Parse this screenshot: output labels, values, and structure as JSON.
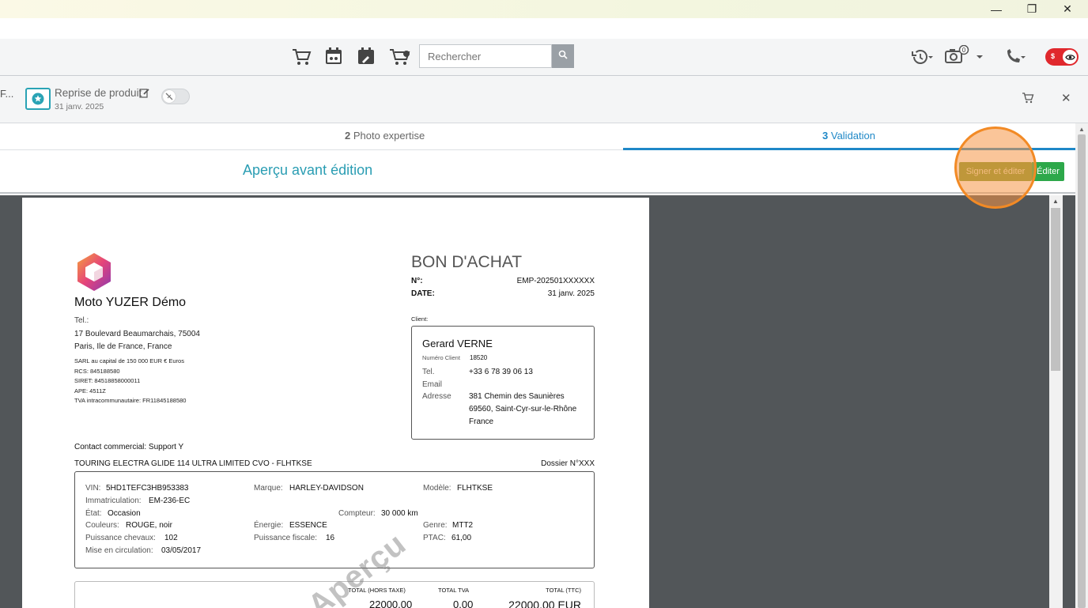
{
  "window": {
    "minimize": "—",
    "maximize": "❐",
    "close": "✕"
  },
  "toolbar": {
    "search_placeholder": "Rechercher",
    "icons": [
      "cart-icon",
      "calendar-icon",
      "repair-icon",
      "moto-cart-icon",
      "search-icon",
      "history-icon",
      "camera-icon",
      "phone-icon"
    ],
    "camera_badge": "0",
    "toggle_symbol": "$"
  },
  "docbar": {
    "truncated_tab": "F...",
    "title": "Reprise de produit",
    "date": "31 janv. 2025"
  },
  "steps": {
    "step2_num": "2",
    "step2_label": "Photo expertise",
    "step3_num": "3",
    "step3_label": "Validation"
  },
  "preview": {
    "title": "Aperçu avant édition",
    "sign_button": "Signer et éditer",
    "edit_button": "Éditer"
  },
  "colors": {
    "accent": "#2a9db3",
    "active_step": "#1f88c7",
    "sign_btn": "#7d9a2e",
    "edit_btn": "#2da84a",
    "highlight": "#f28a25"
  },
  "document": {
    "company_name": "Moto YUZER Démo",
    "tel_label": "Tel.:",
    "address1": "17 Boulevard Beaumarchais, 75004",
    "address2": "Paris, Ile de France, France",
    "legal1": "SARL au capital de 150 000 EUR € Euros",
    "legal2": "RCS: 845188580",
    "legal3": "SIRET: 84518858000011",
    "legal4": "APE: 4511Z",
    "legal5": "TVA intracommunautaire: FR11845188580",
    "doc_title": "BON D'ACHAT",
    "num_label": "N°:",
    "num_value": "EMP-202501XXXXXX",
    "date_label": "DATE:",
    "date_value": "31 janv. 2025",
    "client_label": "Client:",
    "client": {
      "name": "Gerard VERNE",
      "numero_label": "Numéro Client",
      "numero_value": "18520",
      "tel_label": "Tel.",
      "tel_value": "+33 6 78 39 06 13",
      "email_label": "Email",
      "adresse_label": "Adresse",
      "adresse1": "381 Chemin des Saunières",
      "adresse2": "69560, Saint-Cyr-sur-le-Rhône",
      "adresse3": "France"
    },
    "contact": "Contact commercial: Support Y",
    "vehicle_title": "TOURING ELECTRA GLIDE 114 ULTRA LIMITED CVO - FLHTKSE",
    "dossier": "Dossier N°XXX",
    "vehicle": {
      "vin_label": "VIN:",
      "vin": "5HD1TEFC3HB953383",
      "marque_label": "Marque:",
      "marque": "HARLEY-DAVIDSON",
      "modele_label": "Modèle:",
      "modele": "FLHTKSE",
      "immat_label": "Immatriculation:",
      "immat": "EM-236-EC",
      "etat_label": "État:",
      "etat": "Occasion",
      "compteur_label": "Compteur:",
      "compteur": "30 000 km",
      "couleurs_label": "Couleurs:",
      "couleurs": "ROUGE, noir",
      "energie_label": "Énergie:",
      "energie": "ESSENCE",
      "genre_label": "Genre:",
      "genre": "MTT2",
      "chevaux_label": "Puissance chevaux:",
      "chevaux": "102",
      "fiscale_label": "Puissance fiscale:",
      "fiscale": "16",
      "ptac_label": "PTAC:",
      "ptac": "61,00",
      "mec_label": "Mise en circulation:",
      "mec": "03/05/2017"
    },
    "totals": {
      "ht_label": "TOTAL (HORS TAXE)",
      "ht": "22000,00",
      "tva_label": "TOTAL TVA",
      "tva": "0,00",
      "ttc_label": "TOTAL (TTC)",
      "ttc": "22000,00 EUR"
    },
    "watermark": "Aperçu"
  }
}
